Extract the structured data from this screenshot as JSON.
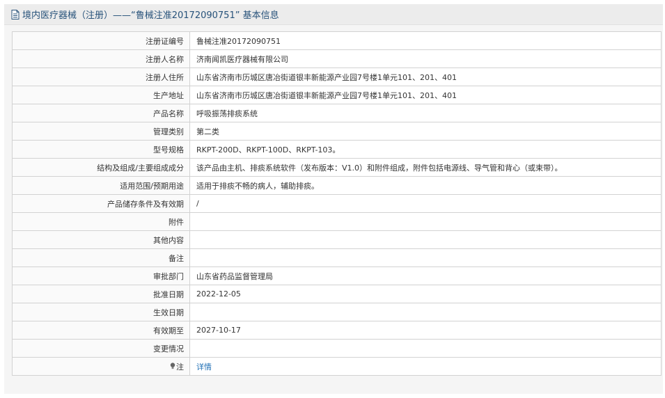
{
  "header": {
    "title": "境内医疗器械（注册）——“鲁械注准20172090751” 基本信息",
    "icon": "document-icon"
  },
  "rows": [
    {
      "label": "注册证编号",
      "value": "鲁械注准20172090751"
    },
    {
      "label": "注册人名称",
      "value": "济南闻凯医疗器械有限公司"
    },
    {
      "label": "注册人住所",
      "value": "山东省济南市历城区唐冶街道银丰新能源产业园7号楼1单元101、201、401"
    },
    {
      "label": "生产地址",
      "value": "山东省济南市历城区唐冶街道银丰新能源产业园7号楼1单元101、201、401"
    },
    {
      "label": "产品名称",
      "value": "呼吸振荡排痰系统"
    },
    {
      "label": "管理类别",
      "value": "第二类"
    },
    {
      "label": "型号规格",
      "value": "RKPT-200D、RKPT-100D、RKPT-103。"
    },
    {
      "label": "结构及组成/主要组成成分",
      "value": "该产品由主机、排痰系统软件（发布版本：V1.0）和附件组成，附件包括电源线、导气管和背心（或束带）。"
    },
    {
      "label": "适用范围/预期用途",
      "value": "适用于排痰不畅的病人，辅助排痰。"
    },
    {
      "label": "产品储存条件及有效期",
      "value": "/"
    },
    {
      "label": "附件",
      "value": ""
    },
    {
      "label": "其他内容",
      "value": ""
    },
    {
      "label": "备注",
      "value": ""
    },
    {
      "label": "审批部门",
      "value": "山东省药品监督管理局"
    },
    {
      "label": "批准日期",
      "value": "2022-12-05"
    },
    {
      "label": "生效日期",
      "value": ""
    },
    {
      "label": "有效期至",
      "value": "2027-10-17"
    },
    {
      "label": "变更情况",
      "value": ""
    }
  ],
  "note_row": {
    "icon": "lightbulb-icon",
    "label": "注",
    "link": "详情"
  },
  "colors": {
    "header_text": "#27527a",
    "link": "#1f6fb5",
    "border": "#d2d2d2"
  }
}
